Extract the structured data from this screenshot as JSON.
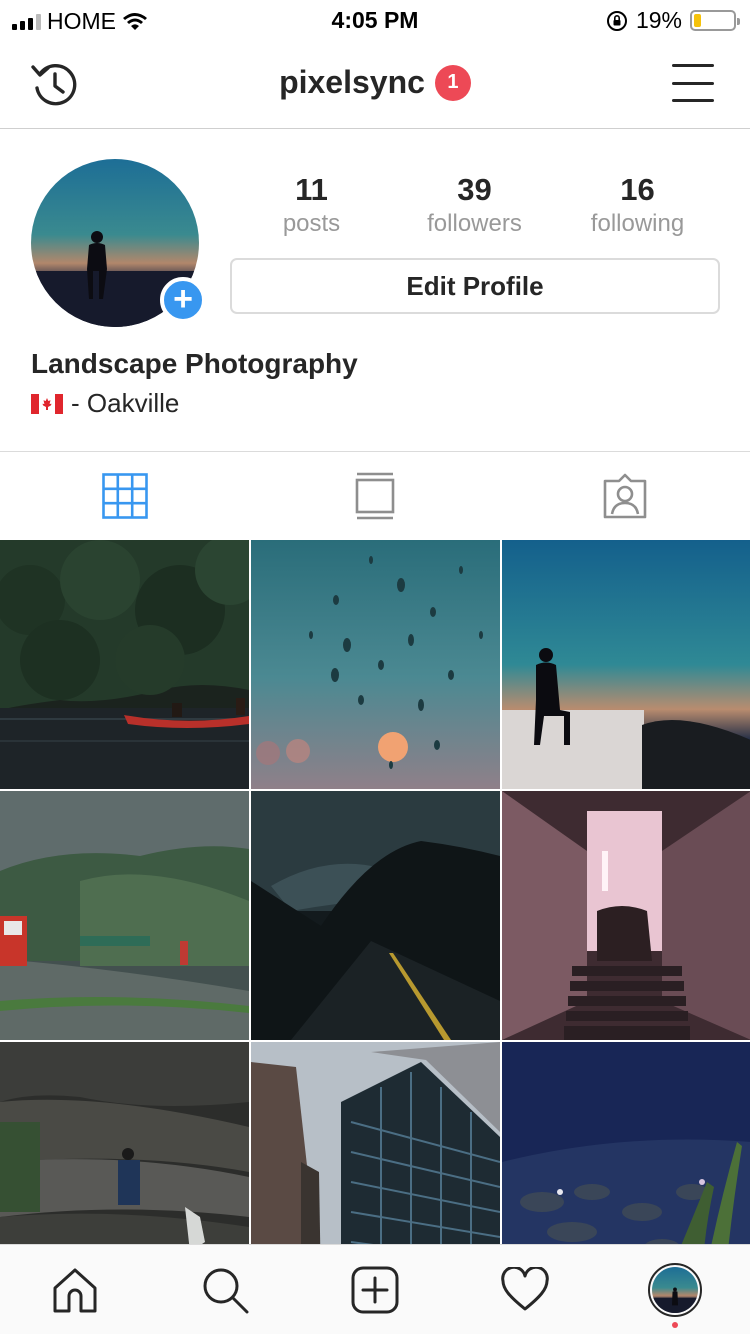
{
  "status_bar": {
    "carrier": "HOME",
    "time": "4:05 PM",
    "battery": "19%",
    "battery_level": 0.19
  },
  "nav": {
    "username": "pixelsync",
    "notification_count": "1"
  },
  "profile": {
    "stats": [
      {
        "value": "11",
        "label": "posts"
      },
      {
        "value": "39",
        "label": "followers"
      },
      {
        "value": "16",
        "label": "following"
      }
    ],
    "edit_label": "Edit Profile",
    "display_name": "Landscape Photography",
    "location": "- Oakville"
  },
  "tabs": [
    "grid-icon",
    "feed-icon",
    "tagged-icon"
  ],
  "grid": [
    "canoe-on-lake",
    "raindrops-on-window",
    "silhouette-at-sunset",
    "highway-mountains",
    "dark-mountain-road",
    "pink-stairwell",
    "rocky-waterfall",
    "skyscrapers",
    "blue-water-rocks"
  ],
  "tabbar": [
    "home-icon",
    "search-icon",
    "add-icon",
    "heart-icon",
    "profile-avatar"
  ],
  "colors": {
    "accent": "#3897f0",
    "badge": "#ed4956",
    "battery": "#f5c20b"
  }
}
